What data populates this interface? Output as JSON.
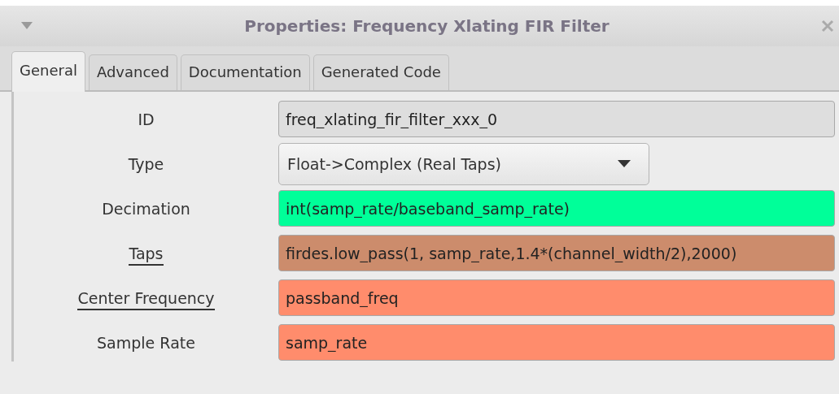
{
  "window": {
    "title": "Properties: Frequency Xlating FIR Filter"
  },
  "tabs": [
    {
      "label": "General",
      "selected": true
    },
    {
      "label": "Advanced",
      "selected": false
    },
    {
      "label": "Documentation",
      "selected": false
    },
    {
      "label": "Generated Code",
      "selected": false
    }
  ],
  "params": [
    {
      "label": "ID",
      "underlined": false,
      "kind": "entry",
      "value": "freq_xlating_fir_filter_xxx_0",
      "color": "#dedede"
    },
    {
      "label": "Type",
      "underlined": false,
      "kind": "dropdown",
      "value": "Float->Complex (Real Taps)"
    },
    {
      "label": "Decimation",
      "underlined": false,
      "kind": "entry",
      "value": "int(samp_rate/baseband_samp_rate)",
      "color": "#00ff99"
    },
    {
      "label": "Taps",
      "underlined": true,
      "kind": "entry",
      "value": "firdes.low_pass(1, samp_rate,1.4*(channel_width/2),2000)",
      "color": "#cc8c6c"
    },
    {
      "label": "Center Frequency",
      "underlined": true,
      "kind": "entry",
      "value": "passband_freq",
      "color": "#ff8c6c"
    },
    {
      "label": "Sample Rate",
      "underlined": false,
      "kind": "entry",
      "value": "samp_rate",
      "color": "#ff8c6c"
    }
  ]
}
